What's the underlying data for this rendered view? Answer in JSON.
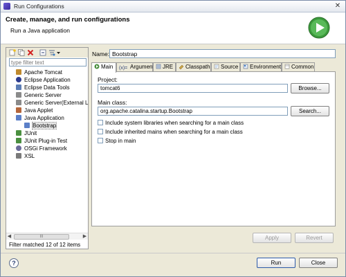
{
  "window": {
    "title": "Run Configurations",
    "close_glyph": "✕"
  },
  "header": {
    "title": "Create, manage, and run configurations",
    "subtitle": "Run a Java application",
    "badge_icon": "run-icon"
  },
  "sidebar": {
    "toolbar_icons": [
      "new-config-icon",
      "duplicate-icon",
      "delete-icon",
      "collapse-all-icon",
      "filter-icon",
      "dropdown-arrow-icon"
    ],
    "filter_placeholder": "type filter text",
    "items": [
      {
        "label": "Apache Tomcat",
        "icon": "tomcat-icon",
        "color": "#c08a2e"
      },
      {
        "label": "Eclipse Application",
        "icon": "eclipse-icon",
        "color": "#2c3b8f"
      },
      {
        "label": "Eclipse Data Tools",
        "icon": "data-tools-icon",
        "color": "#5c7db5"
      },
      {
        "label": "Generic Server",
        "icon": "server-icon",
        "color": "#8a8a8a"
      },
      {
        "label": "Generic Server(External L",
        "icon": "server-icon",
        "color": "#8a8a8a"
      },
      {
        "label": "Java Applet",
        "icon": "applet-icon",
        "color": "#b5663a"
      },
      {
        "label": "Java Application",
        "icon": "java-app-icon",
        "color": "#5b7fc8"
      },
      {
        "label": "Bootstrap",
        "icon": "java-class-icon",
        "color": "#5b7fc8",
        "selected": true
      },
      {
        "label": "JUnit",
        "icon": "junit-icon",
        "color": "#4a8f3f"
      },
      {
        "label": "JUnit Plug-in Test",
        "icon": "junit-plugin-icon",
        "color": "#4a8f3f"
      },
      {
        "label": "OSGi Framework",
        "icon": "osgi-icon",
        "color": "#6b6b9a"
      },
      {
        "label": "XSL",
        "icon": "xsl-icon",
        "color": "#7a7a7a"
      }
    ],
    "scroll_glyph": "III",
    "status": "Filter matched 12 of 12 items"
  },
  "config": {
    "name_label": "Name:",
    "name_value": "Bootstrap",
    "tabs": [
      {
        "label": "Main",
        "icon": "main-tab-icon",
        "active": true
      },
      {
        "label": "Arguments",
        "icon": "arguments-tab-icon"
      },
      {
        "label": "JRE",
        "icon": "jre-tab-icon"
      },
      {
        "label": "Classpath",
        "icon": "classpath-tab-icon"
      },
      {
        "label": "Source",
        "icon": "source-tab-icon"
      },
      {
        "label": "Environment",
        "icon": "environment-tab-icon"
      },
      {
        "label": "Common",
        "icon": "common-tab-icon"
      }
    ],
    "project_label": "Project:",
    "project_value": "tomcat6",
    "browse_label": "Browse...",
    "main_class_label": "Main class:",
    "main_class_value": "org.apache.catalina.startup.Bootstrap",
    "search_label": "Search...",
    "options": [
      {
        "label": "Include system libraries when searching for a main class",
        "checked": false
      },
      {
        "label": "Include inherited mains when searching for a main class",
        "checked": false
      },
      {
        "label": "Stop in main",
        "checked": false
      }
    ],
    "apply_label": "Apply",
    "revert_label": "Revert"
  },
  "footer": {
    "help_glyph": "?",
    "run_label": "Run",
    "close_label": "Close"
  }
}
